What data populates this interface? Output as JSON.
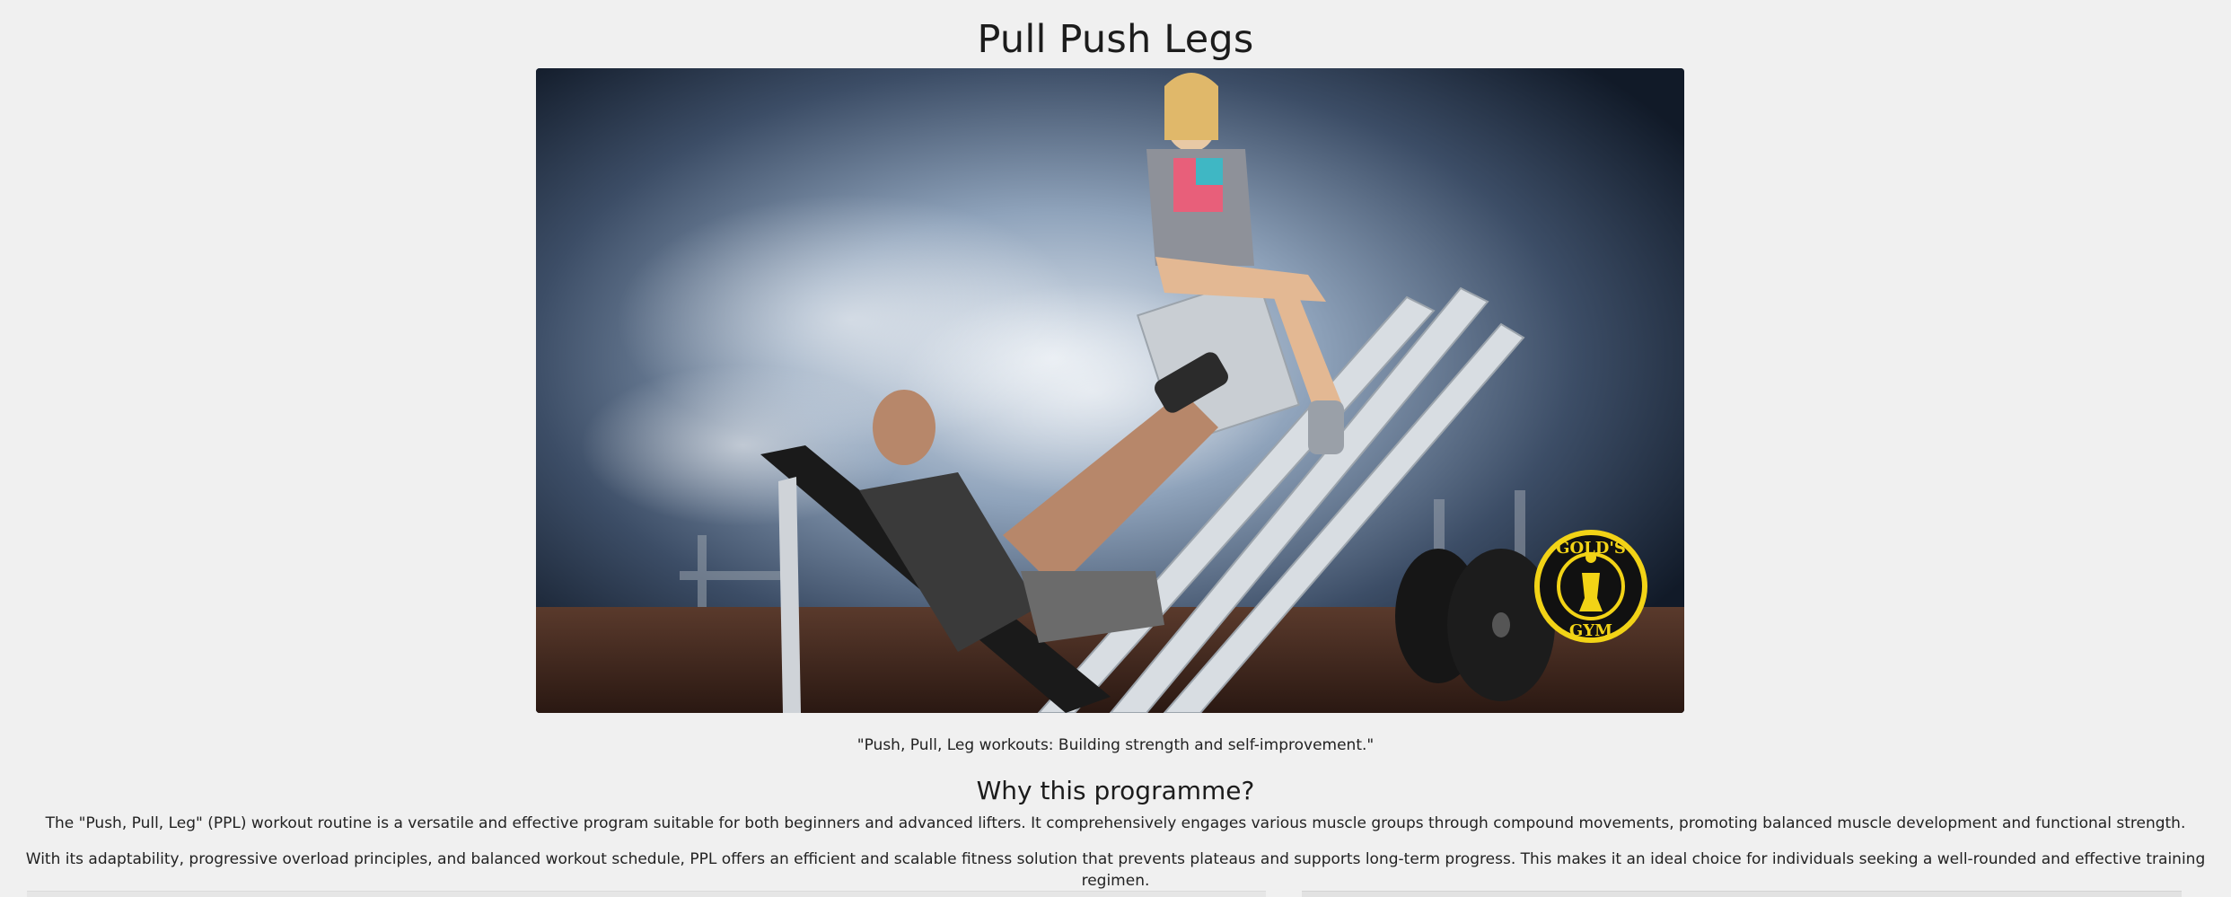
{
  "page": {
    "title": "Pull Push Legs"
  },
  "hero": {
    "logo_icon": "golds-gym-logo-icon",
    "logo_text": "GOLD'S GYM",
    "logo_color": "#f2d316"
  },
  "caption": "\"Push, Pull, Leg workouts: Building strength and self-improvement.\"",
  "section": {
    "heading": "Why this programme?",
    "paragraphs": [
      "The \"Push, Pull, Leg\" (PPL) workout routine is a versatile and effective program suitable for both beginners and advanced lifters. It comprehensively engages various muscle groups through compound movements, promoting balanced muscle development and functional strength.",
      "With its adaptability, progressive overload principles, and balanced workout schedule, PPL offers an efficient and scalable fitness solution that prevents plateaus and supports long-term progress. This makes it an ideal choice for individuals seeking a well-rounded and effective training regimen."
    ]
  },
  "colors": {
    "background": "#f0f0f0",
    "text": "#222222"
  }
}
